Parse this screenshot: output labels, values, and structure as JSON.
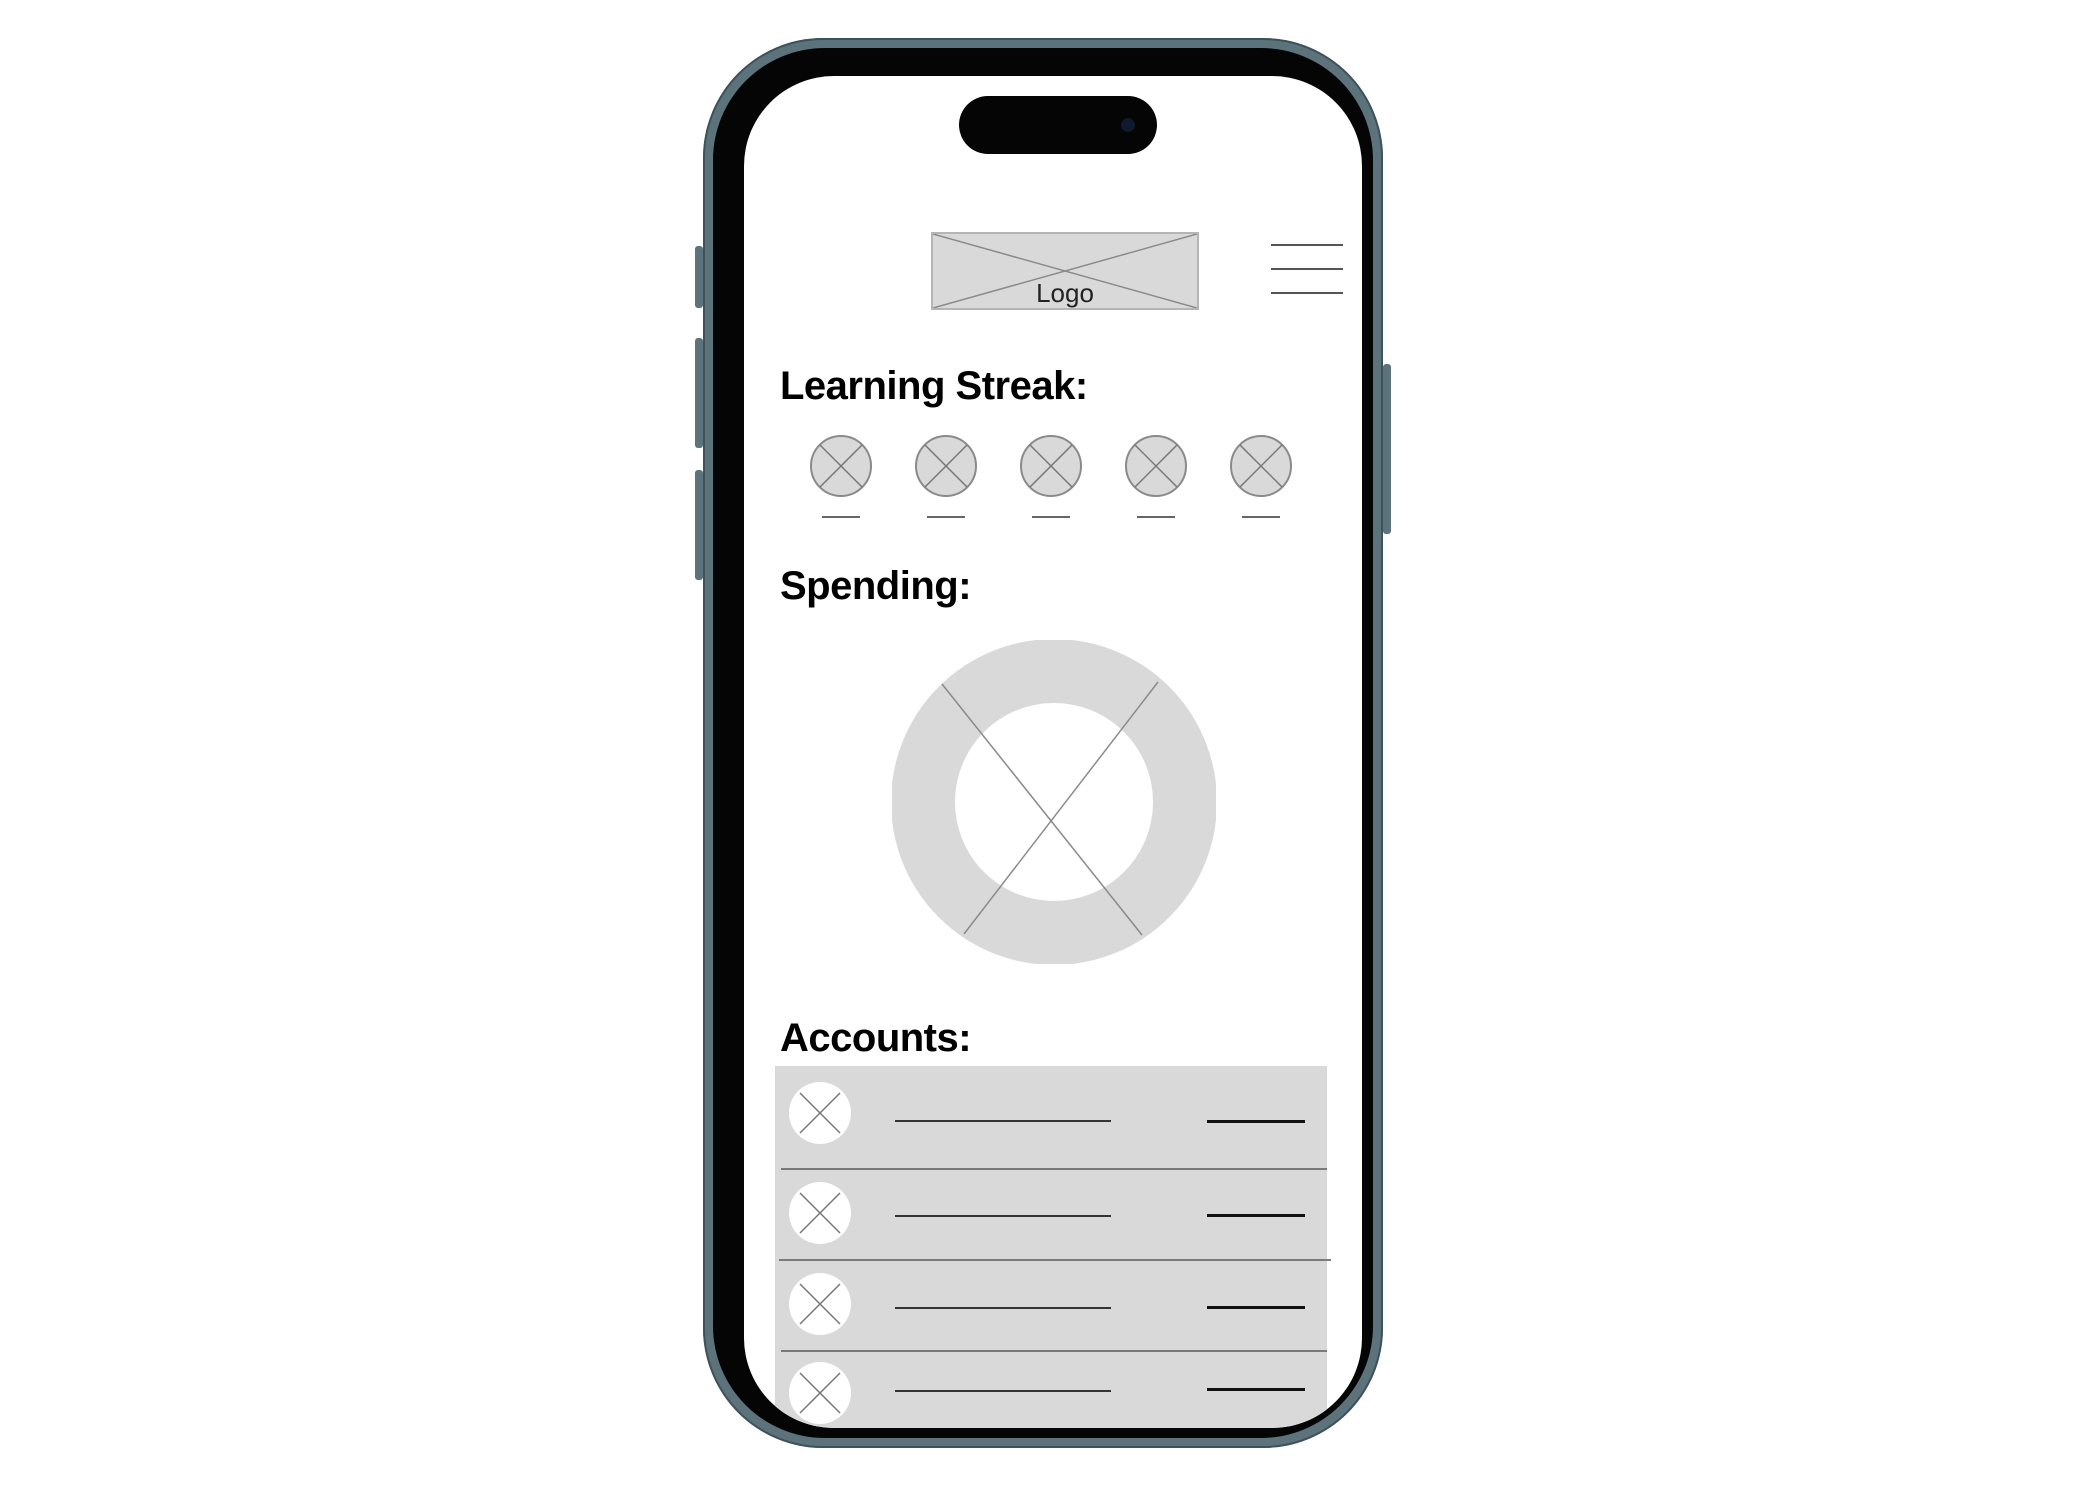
{
  "header": {
    "logo_label": "Logo"
  },
  "sections": {
    "streak_title": "Learning Streak:",
    "spending_title": "Spending:",
    "accounts_title": "Accounts:"
  },
  "colors": {
    "frame": "#5d737b",
    "placeholder_fill": "#d9d9d9",
    "placeholder_stroke": "#8a8a8a"
  },
  "icons": {
    "logo": "image-placeholder-icon",
    "menu": "hamburger-menu-icon",
    "streak_day": "image-placeholder-icon",
    "spending_chart": "donut-chart-placeholder-icon",
    "account": "image-placeholder-icon"
  }
}
